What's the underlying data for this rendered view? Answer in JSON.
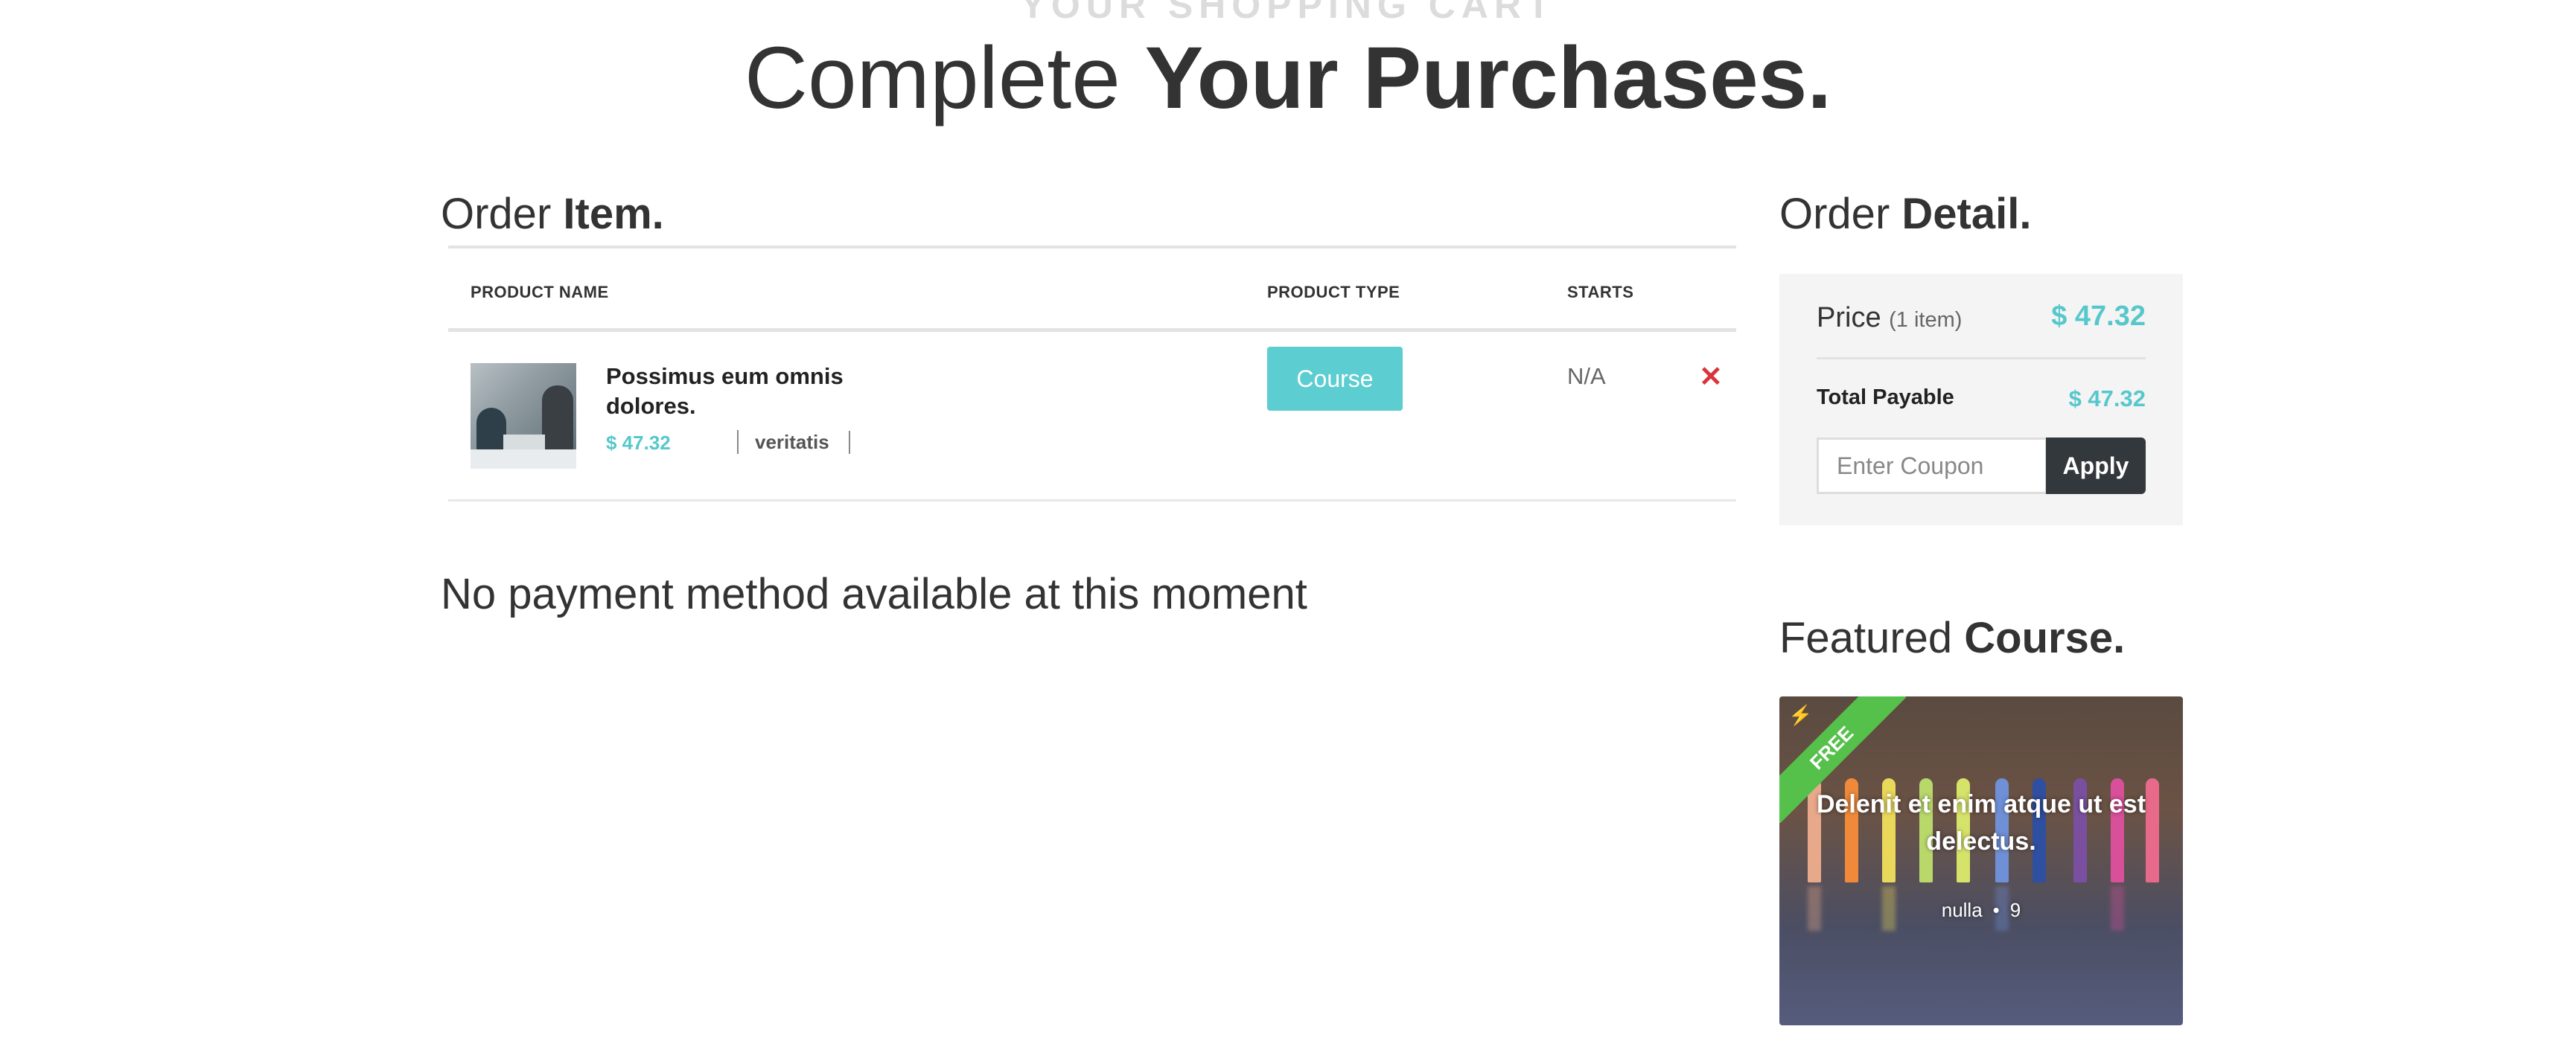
{
  "header": {
    "kicker": "YOUR SHOPPING CART",
    "title_light": "Complete",
    "title_bold": "Your Purchases."
  },
  "order_items": {
    "title_light": "Order",
    "title_bold": "Item.",
    "columns": [
      "PRODUCT NAME",
      "PRODUCT TYPE",
      "STARTS"
    ],
    "rows": [
      {
        "name": "Possimus eum omnis dolores.",
        "price": "$ 47.32",
        "meta": "veritatis",
        "type": "Course",
        "starts": "N/A",
        "remove": "✕"
      }
    ]
  },
  "payment": {
    "message": "No payment method available at this moment"
  },
  "order_detail": {
    "title_light": "Order",
    "title_bold": "Detail.",
    "price_label": "Price",
    "price_count": "(1 item)",
    "price_value": "$ 47.32",
    "total_label": "Total Payable",
    "total_value": "$ 47.32",
    "coupon_placeholder": "Enter Coupon",
    "apply_label": "Apply"
  },
  "featured": {
    "title_light": "Featured",
    "title_bold": "Course.",
    "badge": "FREE",
    "course_title": "Delenit et enim atque ut est delectus.",
    "category": "nulla",
    "count": "9"
  },
  "colors": {
    "accent": "#56c8cc",
    "remove": "#d9343c",
    "free_badge": "#55c14b",
    "dark_button": "#33383d"
  }
}
